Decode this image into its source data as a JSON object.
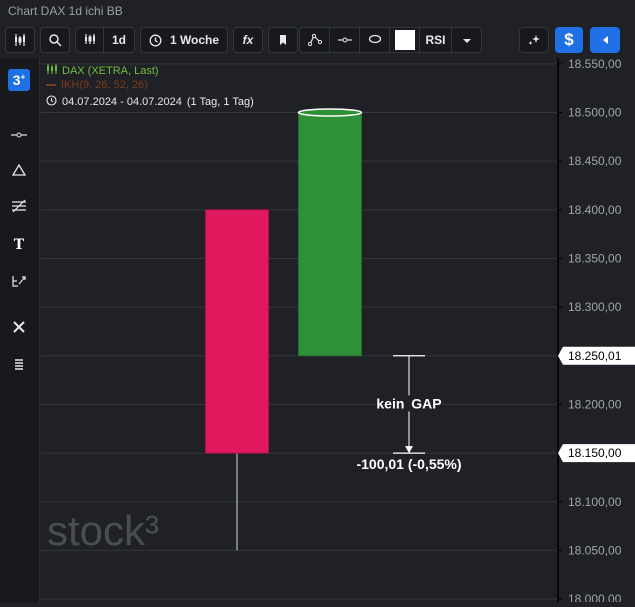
{
  "window": {
    "title": "Chart DAX 1d ichi BB"
  },
  "toolbar": {
    "interval": "1d",
    "range": "1 Woche",
    "fx": "fx",
    "rsi": "RSI"
  },
  "legend": {
    "instrument": "DAX (XETRA, Last)",
    "indicator": "IKH(9, 26, 52, 26)",
    "period": "04.07.2024 - 04.07.2024",
    "period_detail": "(1 Tag, 1 Tag)"
  },
  "colors": {
    "down": "#e0185e",
    "up": "#2e9137",
    "legend_instrument": "#6fbf3f",
    "legend_indicator": "#7a3b1e",
    "background": "#1f2126"
  },
  "icons": {
    "toolbar": [
      "candlestick-icon",
      "search-icon",
      "bars-icon",
      "clock-icon",
      "bookmark-icon",
      "draw-line-icon",
      "horizontal-line-icon",
      "ellipse-icon",
      "caret-down-icon",
      "sparkle-icon",
      "dollar-icon",
      "play-left-icon"
    ],
    "sidebar": [
      "stock3-logo-icon",
      "horizontal-line-icon",
      "triangle-icon",
      "fibonacci-icon",
      "text-icon",
      "annotate-icon",
      "tools-icon",
      "list-icon"
    ]
  },
  "watermark": "stock³",
  "chart_data": {
    "type": "candlestick",
    "y_axis": {
      "min": 17997,
      "max": 18556,
      "tick_labels": [
        "18.550,00",
        "18.500,00",
        "18.450,00",
        "18.400,00",
        "18.350,00",
        "18.300,00",
        "18.250,00",
        "18.200,00",
        "18.150,00",
        "18.100,00",
        "18.050,00",
        "18.000,00"
      ],
      "ticks": [
        18550,
        18500,
        18450,
        18400,
        18350,
        18300,
        18250,
        18200,
        18150,
        18100,
        18050,
        18000
      ]
    },
    "candles": [
      {
        "open": 18400,
        "high": 18400,
        "low": 18050,
        "close": 18150,
        "direction": "down"
      },
      {
        "open": 18250,
        "high": 18500,
        "low": 18250,
        "close": 18500,
        "direction": "up"
      }
    ],
    "price_markers": [
      {
        "value": 18250.01,
        "label": "18.250,01"
      },
      {
        "value": 18150.0,
        "label": "18.150,00"
      }
    ],
    "annotation": {
      "label": "kein GAP",
      "change_label": "-100,01 (-0,55%)",
      "from": 18250.01,
      "to": 18150.0
    },
    "grid": true
  }
}
